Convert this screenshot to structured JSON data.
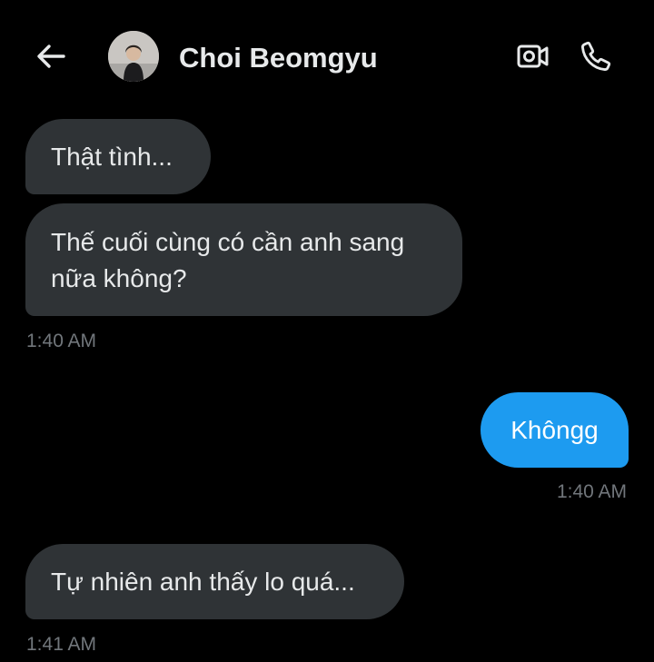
{
  "header": {
    "contact_name": "Choi Beomgyu",
    "back_icon": "arrow-left-icon",
    "video_icon": "video-camera-icon",
    "call_icon": "phone-icon"
  },
  "messages": [
    {
      "direction": "incoming",
      "text": "Thật tình..."
    },
    {
      "direction": "incoming",
      "text": "Thế cuối cùng có cần anh sang\nnữa không?",
      "timestamp": "1:40 AM"
    },
    {
      "direction": "outgoing",
      "text": "Khôngg",
      "timestamp": "1:40 AM"
    },
    {
      "direction": "incoming",
      "text": "Tự nhiên anh thấy lo quá...",
      "timestamp": "1:41 AM"
    }
  ],
  "colors": {
    "background": "#000000",
    "incoming_bubble": "#2f3336",
    "outgoing_bubble": "#1d9bf0",
    "timestamp": "#71767b",
    "text": "#e7e9ea"
  }
}
